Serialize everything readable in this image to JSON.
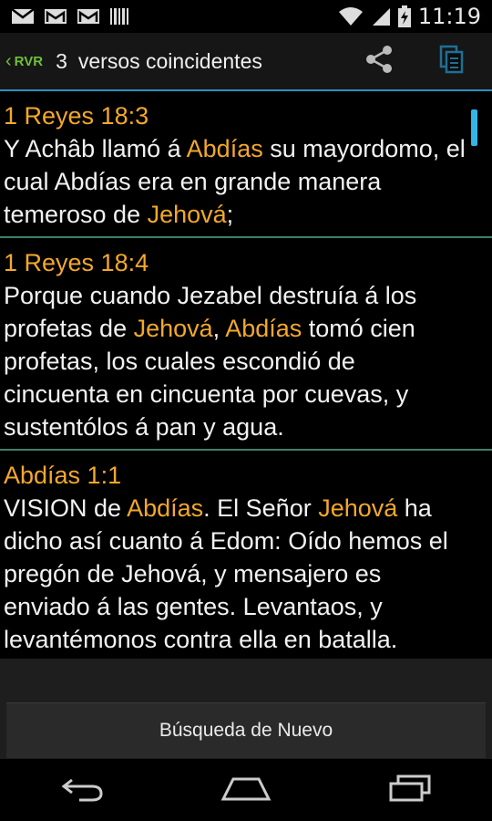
{
  "status_bar": {
    "time": "11:19",
    "icons": [
      "gmail-icon",
      "gmail-icon",
      "gmail-icon",
      "barcode-icon",
      "wifi-icon",
      "signal-icon",
      "battery-charging-icon"
    ]
  },
  "action_bar": {
    "version": "RVR",
    "count": "3",
    "title": "versos coincidentes",
    "share_icon": "share-icon",
    "copy_icon": "copy-icon"
  },
  "results": [
    {
      "reference": "1 Reyes 18:3",
      "segments": [
        {
          "text": "Y Achâb llamó á ",
          "hl": false
        },
        {
          "text": "Abdías",
          "hl": true
        },
        {
          "text": " su mayordomo, el cual Abdías era en grande manera temeroso de ",
          "hl": false
        },
        {
          "text": "Jehová",
          "hl": true
        },
        {
          "text": ";",
          "hl": false
        }
      ]
    },
    {
      "reference": "1 Reyes 18:4",
      "segments": [
        {
          "text": "Porque cuando Jezabel destruía á los profetas de ",
          "hl": false
        },
        {
          "text": "Jehová",
          "hl": true
        },
        {
          "text": ", ",
          "hl": false
        },
        {
          "text": "Abdías",
          "hl": true
        },
        {
          "text": " tomó cien profetas, los cuales escondió de cincuenta en cincuenta por cuevas, y sustentólos á pan y agua.",
          "hl": false
        }
      ]
    },
    {
      "reference": "Abdías 1:1",
      "segments": [
        {
          "text": "VISION de ",
          "hl": false
        },
        {
          "text": "Abdías",
          "hl": true
        },
        {
          "text": ". El Señor ",
          "hl": false
        },
        {
          "text": "Jehová",
          "hl": true
        },
        {
          "text": " ha dicho así cuanto á Edom: Oído hemos el pregón de Jehová, y mensajero es enviado á las gentes. Levantaos, y levantémonos contra ella en batalla.",
          "hl": false
        }
      ]
    }
  ],
  "footer": {
    "search_again_label": "Búsqueda de Nuevo"
  },
  "nav_bar": {
    "icons": [
      "back-icon",
      "home-icon",
      "recent-apps-icon"
    ]
  },
  "colors": {
    "highlight": "#f4a82a",
    "accent": "#33b5e5",
    "version_green": "#6fbf3b",
    "divider": "#3e7f6a"
  }
}
